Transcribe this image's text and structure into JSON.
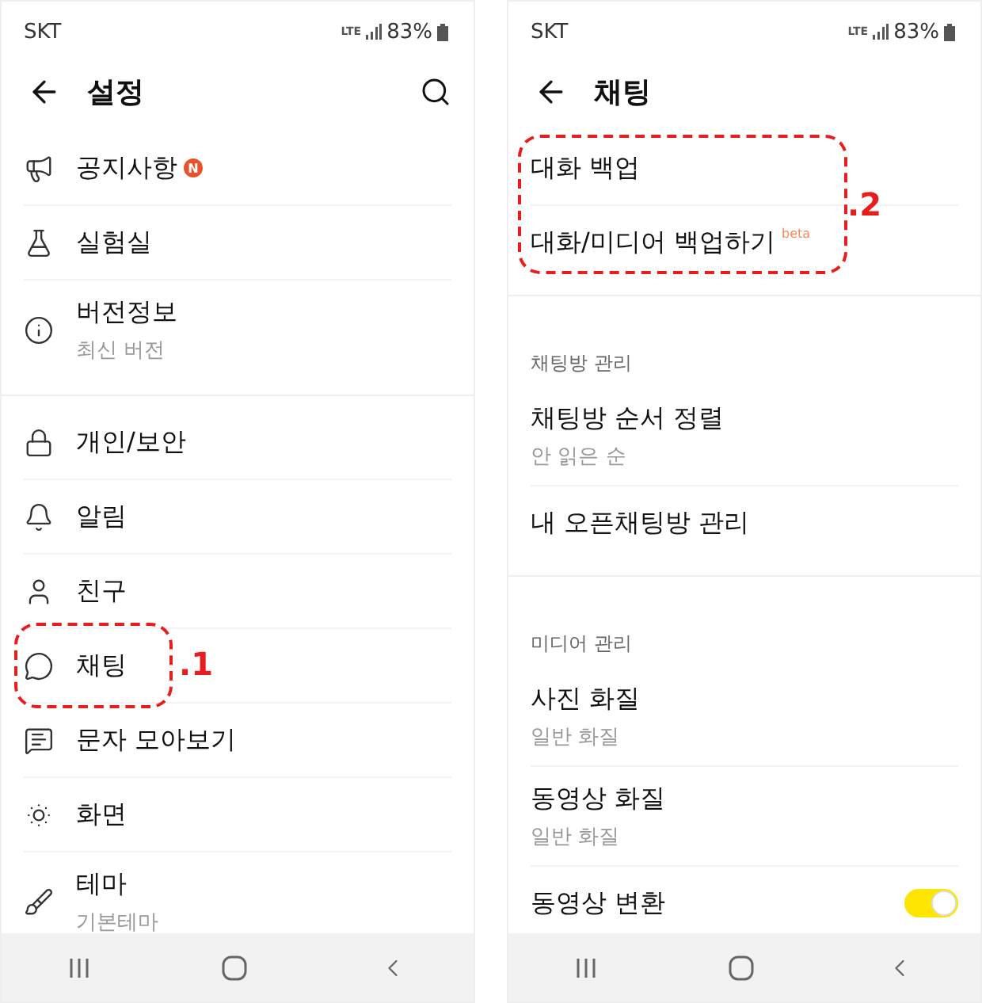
{
  "screens": [
    {
      "status_bar": {
        "carrier": "SKT",
        "network": "LTE",
        "battery": "83%"
      },
      "header": {
        "title": "설정",
        "search": true
      },
      "sections": [
        {
          "items": [
            {
              "title": "공지사항",
              "badge": "N"
            },
            {
              "title": "실험실"
            },
            {
              "title": "버전정보",
              "subtitle": "최신 버전"
            }
          ]
        },
        {
          "items": [
            {
              "title": "개인/보안"
            },
            {
              "title": "알림"
            },
            {
              "title": "친구"
            },
            {
              "title": "채팅",
              "annotation": ".1"
            },
            {
              "title": "문자 모아보기"
            },
            {
              "title": "화면"
            },
            {
              "title": "테마",
              "subtitle": "기본테마"
            }
          ]
        }
      ]
    },
    {
      "status_bar": {
        "carrier": "SKT",
        "network": "LTE",
        "battery": "83%"
      },
      "header": {
        "title": "채팅",
        "search": false
      },
      "sections": [
        {
          "annotation": ".2",
          "items": [
            {
              "title": "대화 백업"
            },
            {
              "title": "대화/미디어 백업하기",
              "tag": "beta"
            }
          ]
        },
        {
          "label": "채팅방 관리",
          "items": [
            {
              "title": "채팅방 순서 정렬",
              "subtitle": "안 읽은 순"
            },
            {
              "title": "내 오픈채팅방 관리"
            }
          ]
        },
        {
          "label": "미디어 관리",
          "items": [
            {
              "title": "사진 화질",
              "subtitle": "일반 화질"
            },
            {
              "title": "동영상 화질",
              "subtitle": "일반 화질"
            },
            {
              "title": "동영상 변환",
              "kind": "toggle",
              "on": true
            }
          ]
        }
      ]
    }
  ]
}
